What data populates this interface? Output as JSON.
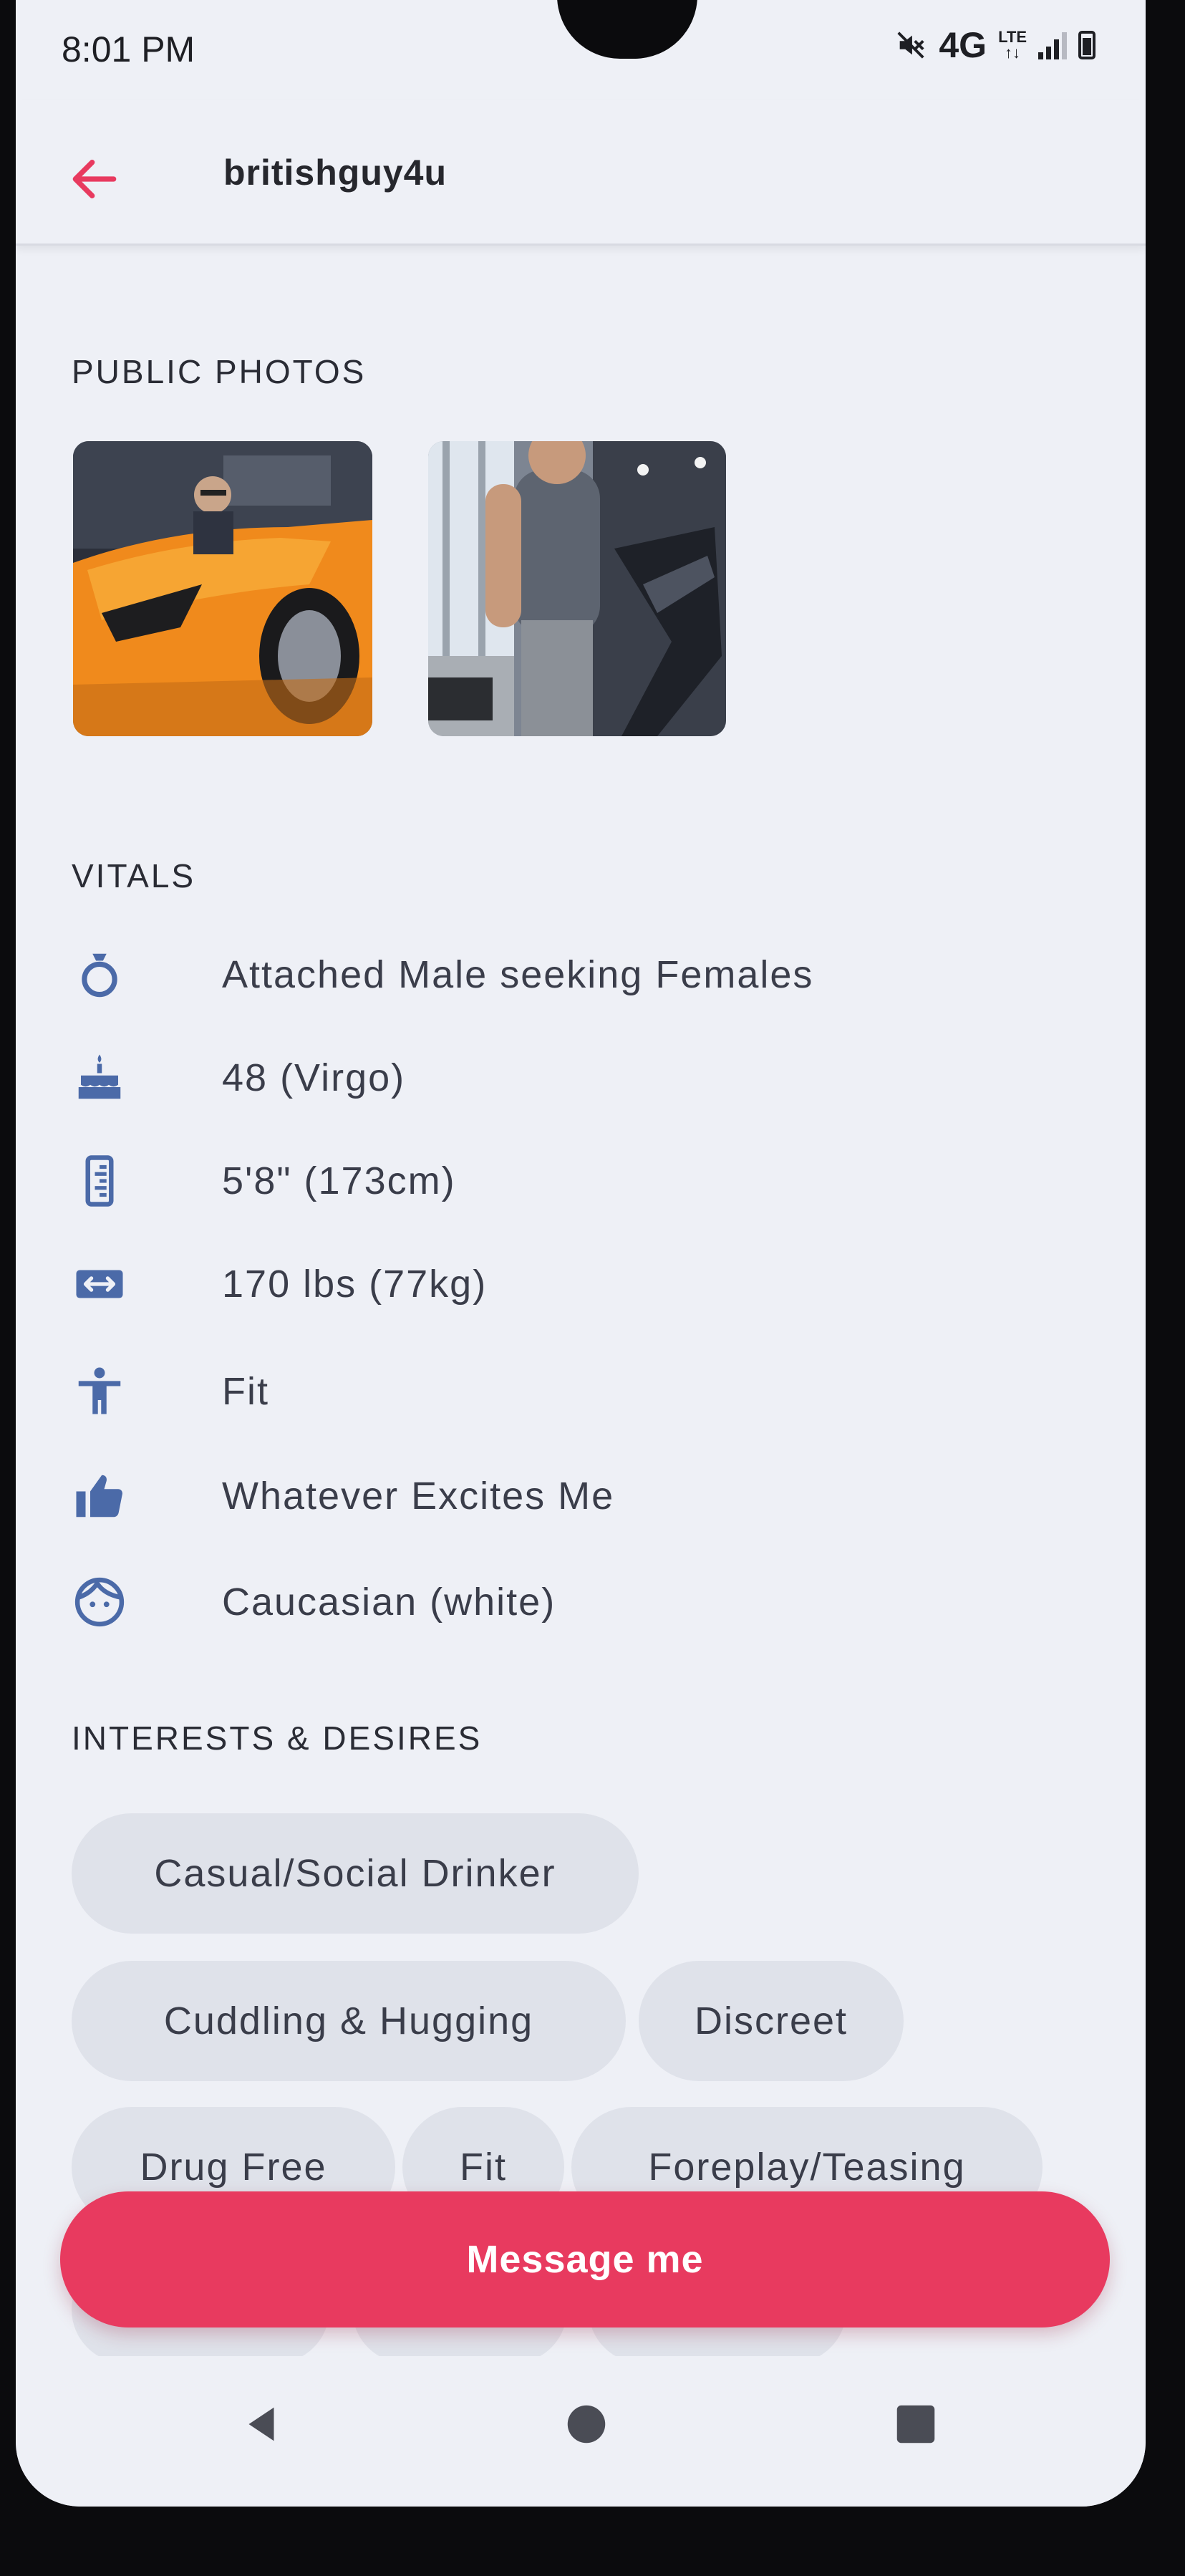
{
  "status_bar": {
    "time": "8:01 PM",
    "network": "4G",
    "network_sub": "LTE"
  },
  "header": {
    "username": "britishguy4u"
  },
  "sections": {
    "public_photos": "PUBLIC PHOTOS",
    "vitals": "VITALS",
    "interests": "INTERESTS & DESIRES"
  },
  "photos": [
    {
      "icon": "sports-car-photo"
    },
    {
      "icon": "gym-photo"
    }
  ],
  "vitals": [
    {
      "icon": "ring-icon",
      "text": "Attached Male seeking Females"
    },
    {
      "icon": "cake-icon",
      "text": "48 (Virgo)"
    },
    {
      "icon": "ruler-icon",
      "text": "5'8\" (173cm)"
    },
    {
      "icon": "width-arrows-icon",
      "text": "170 lbs (77kg)"
    },
    {
      "icon": "person-icon",
      "text": "Fit"
    },
    {
      "icon": "thumbs-up-icon",
      "text": "Whatever Excites Me"
    },
    {
      "icon": "face-icon",
      "text": "Caucasian (white)"
    }
  ],
  "interests": [
    "Casual/Social Drinker",
    "Cuddling & Hugging",
    "Discreet",
    "Drug Free",
    "Fit",
    "Foreplay/Teasing"
  ],
  "actions": {
    "message": "Message me"
  },
  "colors": {
    "accent": "#e83a5f",
    "icon": "#4b6aa8",
    "chip": "#dfe2ea",
    "background": "#eef0f6"
  }
}
